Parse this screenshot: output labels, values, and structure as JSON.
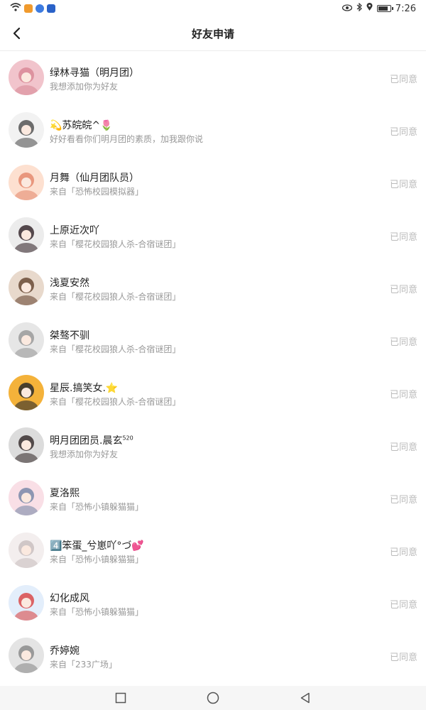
{
  "status_bar": {
    "time": "7:26",
    "battery_level": 0.85,
    "icons": [
      "wifi-icon",
      "app-icon-orange",
      "app-icon-blue",
      "app-icon-shield",
      "eye-icon",
      "bluetooth-icon",
      "location-icon",
      "battery-icon"
    ]
  },
  "header": {
    "title": "好友申请",
    "back_icon": "chevron-left-icon"
  },
  "colors": {
    "status_accepted": "#bbbbbb",
    "message": "#999999",
    "divider": "#ececec"
  },
  "requests": [
    {
      "name": "绿林寻猫（明月团）",
      "message": "我想添加你为好友",
      "status": "已同意",
      "avatar_bg": "#f1c4cc",
      "avatar_fg": "#d98a96"
    },
    {
      "name": "💫苏皖皖^🌷",
      "message": "好好看看你们明月团的素质，加我跟你说",
      "status": "已同意",
      "avatar_bg": "#f2f2f2",
      "avatar_fg": "#555555"
    },
    {
      "name": "月舞（仙月团队员）",
      "message": "来自「恐怖校园模拟器」",
      "status": "已同意",
      "avatar_bg": "#fde0d0",
      "avatar_fg": "#e58a6f"
    },
    {
      "name": "上原近次吖",
      "message": "来自「樱花校园狼人杀-合宿谜团」",
      "status": "已同意",
      "avatar_bg": "#ececec",
      "avatar_fg": "#3a2b30"
    },
    {
      "name": "浅夏安然",
      "message": "来自「樱花校园狼人杀-合宿谜团」",
      "status": "已同意",
      "avatar_bg": "#e8d9cc",
      "avatar_fg": "#6a4a35"
    },
    {
      "name": "桀骜不驯",
      "message": "来自「樱花校园狼人杀-合宿谜团」",
      "status": "已同意",
      "avatar_bg": "#e6e6e6",
      "avatar_fg": "#9a9a9a"
    },
    {
      "name": "星辰.搞笑女.⭐",
      "message": "来自「樱花校园狼人杀-合宿谜团」",
      "status": "已同意",
      "avatar_bg": "#f4b23a",
      "avatar_fg": "#2a2a2a"
    },
    {
      "name": "明月团团员.晨玄",
      "name_sup": "520",
      "message": "我想添加你为好友",
      "status": "已同意",
      "avatar_bg": "#dcdcdc",
      "avatar_fg": "#3a3030"
    },
    {
      "name": "夏洛熙",
      "message": "来自「恐怖小镇躲猫猫」",
      "status": "已同意",
      "avatar_bg": "#f9dfe6",
      "avatar_fg": "#7a8aa8"
    },
    {
      "name": "4️⃣笨蛋_兮崽吖°づ💕",
      "message": "来自「恐怖小镇躲猫猫」",
      "status": "已同意",
      "avatar_bg": "#f3eeee",
      "avatar_fg": "#c9c0bf"
    },
    {
      "name": "幻化成风",
      "message": "来自「恐怖小镇躲猫猫」",
      "status": "已同意",
      "avatar_bg": "#e3eefb",
      "avatar_fg": "#d94a4a"
    },
    {
      "name": "乔婷婉",
      "message": "来自「233广场」",
      "status": "已同意",
      "avatar_bg": "#e4e4e4",
      "avatar_fg": "#8c8c8c"
    }
  ],
  "nav_bar": {
    "buttons": [
      "recent-apps-icon",
      "home-icon",
      "back-triangle-icon"
    ]
  }
}
